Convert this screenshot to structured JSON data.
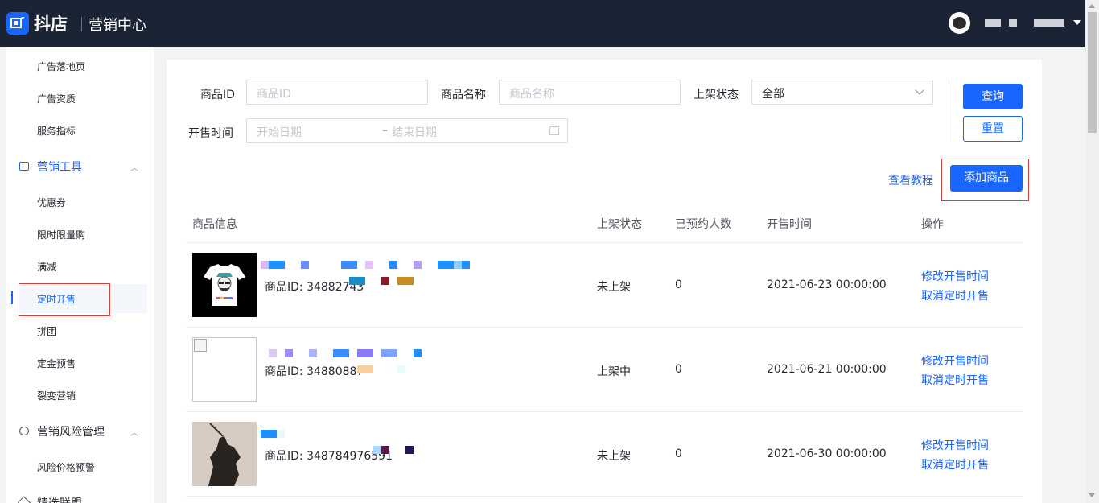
{
  "header": {
    "brand": "抖店",
    "subtitle": "营销中心",
    "user_name_1": "",
    "user_name_2": ""
  },
  "sidebar": {
    "items": [
      {
        "label": "广告落地页"
      },
      {
        "label": "广告资质"
      },
      {
        "label": "服务指标"
      }
    ],
    "group_marketing": "营销工具",
    "marketing_items": [
      {
        "label": "优惠券"
      },
      {
        "label": "限时限量购"
      },
      {
        "label": "满减"
      },
      {
        "label": "定时开售"
      },
      {
        "label": "拼团"
      },
      {
        "label": "定金预售"
      },
      {
        "label": "裂变营销"
      }
    ],
    "group_risk": "营销风险管理",
    "risk_items": [
      {
        "label": "风险价格预警"
      }
    ],
    "group_alliance": "精选联盟"
  },
  "filters": {
    "product_id_label": "商品ID",
    "product_id_placeholder": "商品ID",
    "product_name_label": "商品名称",
    "product_name_placeholder": "商品名称",
    "status_label": "上架状态",
    "status_value": "全部",
    "sale_time_label": "开售时间",
    "start_placeholder": "开始日期",
    "date_sep": "–",
    "end_placeholder": "结束日期",
    "query_button": "查询",
    "reset_button": "重置"
  },
  "actions": {
    "tutorial_link": "查看教程",
    "add_product_button": "添加商品"
  },
  "table": {
    "columns": [
      "商品信息",
      "上架状态",
      "已预约人数",
      "开售时间",
      "操作"
    ],
    "rows": [
      {
        "product_id": "商品ID: 34882743",
        "status": "未上架",
        "reservations": "0",
        "sale_time": "2021-06-23 00:00:00",
        "action_1": "修改开售时间",
        "action_2": "取消定时开售"
      },
      {
        "product_id": "商品ID: 34880887",
        "status": "上架中",
        "reservations": "0",
        "sale_time": "2021-06-21 00:00:00",
        "action_1": "修改开售时间",
        "action_2": "取消定时开售"
      },
      {
        "product_id": "商品ID: 348784976591",
        "status": "未上架",
        "reservations": "0",
        "sale_time": "2021-06-30 00:00:00",
        "action_1": "修改开售时间",
        "action_2": "取消定时开售"
      }
    ]
  },
  "colors": {
    "brand_blue": "#1966ff",
    "topbar": "#1b2435",
    "highlight_red": "#d9423b"
  }
}
